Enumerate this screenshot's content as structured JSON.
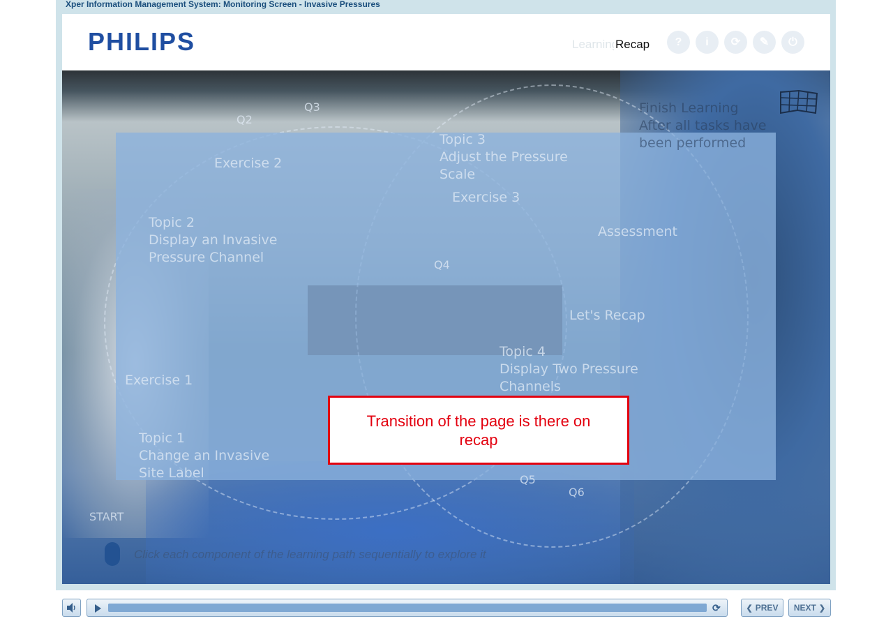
{
  "app": {
    "title": "Xper Information Management System: Monitoring Screen - Invasive Pressures"
  },
  "header": {
    "logo": "PHILIPS",
    "menu": {
      "learning": "Learning",
      "recap": "Recap"
    },
    "buttons": [
      {
        "name": "help",
        "glyph": "?"
      },
      {
        "name": "info",
        "glyph": "i"
      },
      {
        "name": "replay",
        "glyph": "⟳"
      },
      {
        "name": "pen",
        "glyph": "✎"
      },
      {
        "name": "power",
        "glyph": "⏻"
      }
    ]
  },
  "learning_path": {
    "q3": "Q3",
    "q2": "Q2",
    "exercise2": "Exercise 2",
    "topic3_title": "Topic 3",
    "topic3_desc": "Adjust the Pressure Scale",
    "exercise3": "Exercise 3",
    "topic2_title": "Topic 2",
    "topic2_desc": "Display an Invasive Pressure Channel",
    "assessment": "Assessment",
    "q4": "Q4",
    "lets_recap": "Let's Recap",
    "topic4_title": "Topic 4",
    "topic4_desc": "Display Two Pressure Channels",
    "exercise1": "Exercise 1",
    "topic1_title": "Topic 1",
    "topic1_desc": "Change an Invasive Site Label",
    "q5": "Q5",
    "q6": "Q6",
    "start": "START",
    "finish_title": "Finish Learning",
    "finish_desc": "After all tasks have been performed"
  },
  "callout": {
    "text": "Transition of the page is there on recap"
  },
  "hint": "Click each component of the learning path sequentially to explore it",
  "player": {
    "progress": 1.0
  },
  "nav": {
    "prev": "PREV",
    "next": "NEXT"
  },
  "colors": {
    "brand": "#1f4ea1",
    "callout_border": "#e3000f",
    "title_text": "#1b4f7d"
  }
}
